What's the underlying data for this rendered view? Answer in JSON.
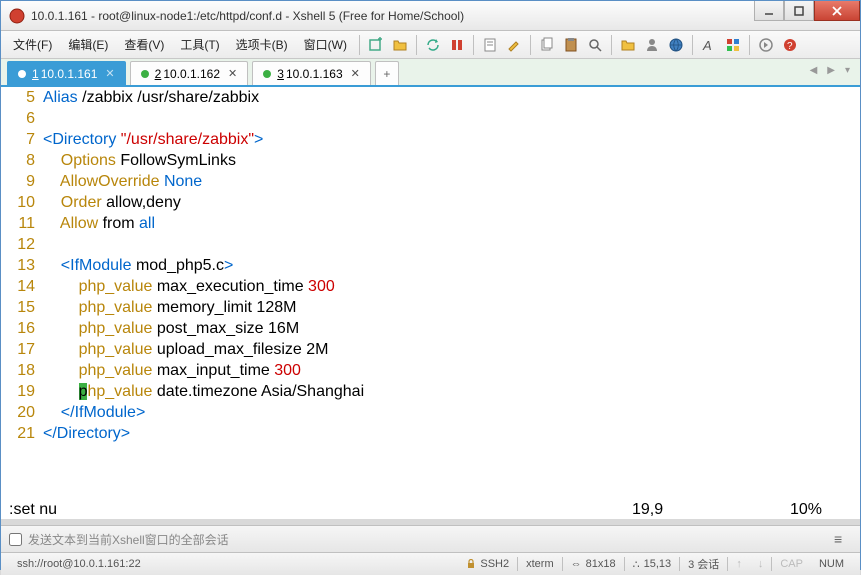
{
  "window": {
    "title": "10.0.1.161 - root@linux-node1:/etc/httpd/conf.d - Xshell 5 (Free for Home/School)"
  },
  "menu": {
    "file": "文件(F)",
    "edit": "编辑(E)",
    "view": "查看(V)",
    "tools": "工具(T)",
    "tabs": "选项卡(B)",
    "window": "窗口(W)"
  },
  "tabs": [
    {
      "num": "1",
      "label": "10.0.1.161",
      "active": true
    },
    {
      "num": "2",
      "label": "10.0.1.162",
      "active": false
    },
    {
      "num": "3",
      "label": "10.0.1.163",
      "active": false
    }
  ],
  "code": {
    "lines": [
      {
        "n": 5,
        "segments": [
          [
            "kw",
            "Alias"
          ],
          [
            "plain",
            " /zabbix /usr/share/zabbix"
          ]
        ]
      },
      {
        "n": 6,
        "segments": []
      },
      {
        "n": 7,
        "segments": [
          [
            "tag",
            "<Directory "
          ],
          [
            "str",
            "\"/usr/share/zabbix\""
          ],
          [
            "tag",
            ">"
          ]
        ]
      },
      {
        "n": 8,
        "segments": [
          [
            "plain",
            "    "
          ],
          [
            "attr",
            "Options"
          ],
          [
            "plain",
            " FollowSymLinks"
          ]
        ]
      },
      {
        "n": 9,
        "segments": [
          [
            "plain",
            "    "
          ],
          [
            "attr",
            "AllowOverride"
          ],
          [
            "plain",
            " "
          ],
          [
            "kw",
            "None"
          ]
        ]
      },
      {
        "n": 10,
        "segments": [
          [
            "plain",
            "    "
          ],
          [
            "attr",
            "Order"
          ],
          [
            "plain",
            " allow,deny"
          ]
        ]
      },
      {
        "n": 11,
        "segments": [
          [
            "plain",
            "    "
          ],
          [
            "attr",
            "Allow"
          ],
          [
            "plain",
            " from "
          ],
          [
            "kw",
            "all"
          ]
        ]
      },
      {
        "n": 12,
        "segments": []
      },
      {
        "n": 13,
        "segments": [
          [
            "plain",
            "    "
          ],
          [
            "tag",
            "<IfModule "
          ],
          [
            "plain",
            "mod_php5.c"
          ],
          [
            "tag",
            ">"
          ]
        ]
      },
      {
        "n": 14,
        "segments": [
          [
            "plain",
            "        "
          ],
          [
            "attr",
            "php_value"
          ],
          [
            "plain",
            " max_execution_time "
          ],
          [
            "val",
            "300"
          ]
        ]
      },
      {
        "n": 15,
        "segments": [
          [
            "plain",
            "        "
          ],
          [
            "attr",
            "php_value"
          ],
          [
            "plain",
            " memory_limit 128M"
          ]
        ]
      },
      {
        "n": 16,
        "segments": [
          [
            "plain",
            "        "
          ],
          [
            "attr",
            "php_value"
          ],
          [
            "plain",
            " post_max_size 16M"
          ]
        ]
      },
      {
        "n": 17,
        "segments": [
          [
            "plain",
            "        "
          ],
          [
            "attr",
            "php_value"
          ],
          [
            "plain",
            " upload_max_filesize 2M"
          ]
        ]
      },
      {
        "n": 18,
        "segments": [
          [
            "plain",
            "        "
          ],
          [
            "attr",
            "php_value"
          ],
          [
            "plain",
            " max_input_time "
          ],
          [
            "val",
            "300"
          ]
        ]
      },
      {
        "n": 19,
        "segments": [
          [
            "plain",
            "        "
          ],
          [
            "cursor",
            "p"
          ],
          [
            "attr",
            "hp_value"
          ],
          [
            "plain",
            " date.timezone Asia/Shanghai"
          ]
        ]
      },
      {
        "n": 20,
        "segments": [
          [
            "plain",
            "    "
          ],
          [
            "tag",
            "</IfModule>"
          ]
        ]
      },
      {
        "n": 21,
        "segments": [
          [
            "tag",
            "</Directory>"
          ]
        ]
      }
    ]
  },
  "vim_status": {
    "command": ":set nu",
    "position": "19,9",
    "scroll": "10%"
  },
  "sendbar": {
    "placeholder": "发送文本到当前Xshell窗口的全部会话"
  },
  "statusbar": {
    "conn": "ssh://root@10.0.1.161:22",
    "proto": "SSH2",
    "term": "xterm",
    "size": "81x18",
    "cursor": "15,13",
    "sessions": "3 会话",
    "cap": "CAP",
    "num": "NUM"
  }
}
